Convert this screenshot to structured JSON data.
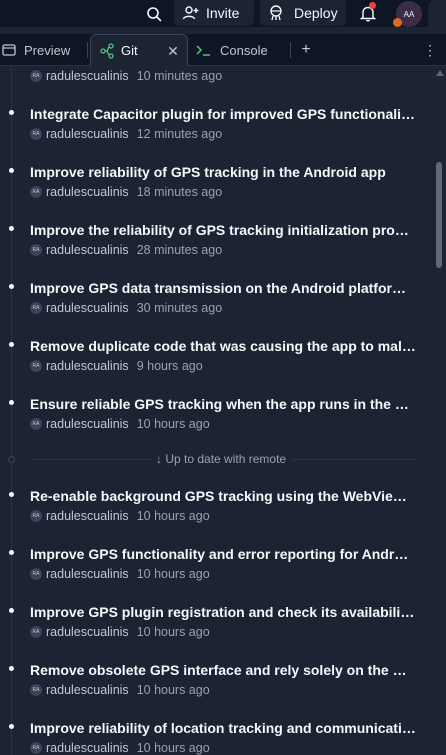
{
  "header": {
    "invite_label": "Invite",
    "deploy_label": "Deploy",
    "avatar_initials": "AA"
  },
  "tabs": [
    {
      "label": "Preview"
    },
    {
      "label": "Git"
    },
    {
      "label": "Console"
    }
  ],
  "commits_before": [
    {
      "message": "",
      "author": "radulescualinis",
      "time": "10 minutes ago",
      "avatar": "RA"
    },
    {
      "message": "Integrate Capacitor plugin for improved GPS functionality and tracking",
      "author": "radulescualinis",
      "time": "12 minutes ago",
      "avatar": "RA"
    },
    {
      "message": "Improve reliability of GPS tracking in the Android app",
      "author": "radulescualinis",
      "time": "18 minutes ago",
      "avatar": "RA"
    },
    {
      "message": "Improve the reliability of GPS tracking initialization process",
      "author": "radulescualinis",
      "time": "28 minutes ago",
      "avatar": "RA"
    },
    {
      "message": "Improve GPS data transmission on the Android platform for accuracy",
      "author": "radulescualinis",
      "time": "30 minutes ago",
      "avatar": "RA"
    },
    {
      "message": "Remove duplicate code that was causing the app to malfunction",
      "author": "radulescualinis",
      "time": "9 hours ago",
      "avatar": "RA"
    },
    {
      "message": "Ensure reliable GPS tracking when the app runs in the background",
      "author": "radulescualinis",
      "time": "10 hours ago",
      "avatar": "RA"
    }
  ],
  "remote_status": "Up to date with remote",
  "commits_after": [
    {
      "message": "Re-enable background GPS tracking using the WebView interface",
      "author": "radulescualinis",
      "time": "10 hours ago",
      "avatar": "RA"
    },
    {
      "message": "Improve GPS functionality and error reporting for Android devices",
      "author": "radulescualinis",
      "time": "10 hours ago",
      "avatar": "RA"
    },
    {
      "message": "Improve GPS plugin registration and check its availability at startup",
      "author": "radulescualinis",
      "time": "10 hours ago",
      "avatar": "RA"
    },
    {
      "message": "Remove obsolete GPS interface and rely solely on the GPS plugin",
      "author": "radulescualinis",
      "time": "10 hours ago",
      "avatar": "RA"
    },
    {
      "message": "Improve reliability of location tracking and communication with server",
      "author": "radulescualinis",
      "time": "10 hours ago",
      "avatar": "RA"
    }
  ],
  "colors": {
    "background": "#1c2333",
    "topbar": "#0e1525",
    "text": "#f5f9fc",
    "muted": "#9da2a6",
    "notification": "#f23f42",
    "git_icon": "#57c47a",
    "console_icon": "#57c47a"
  }
}
